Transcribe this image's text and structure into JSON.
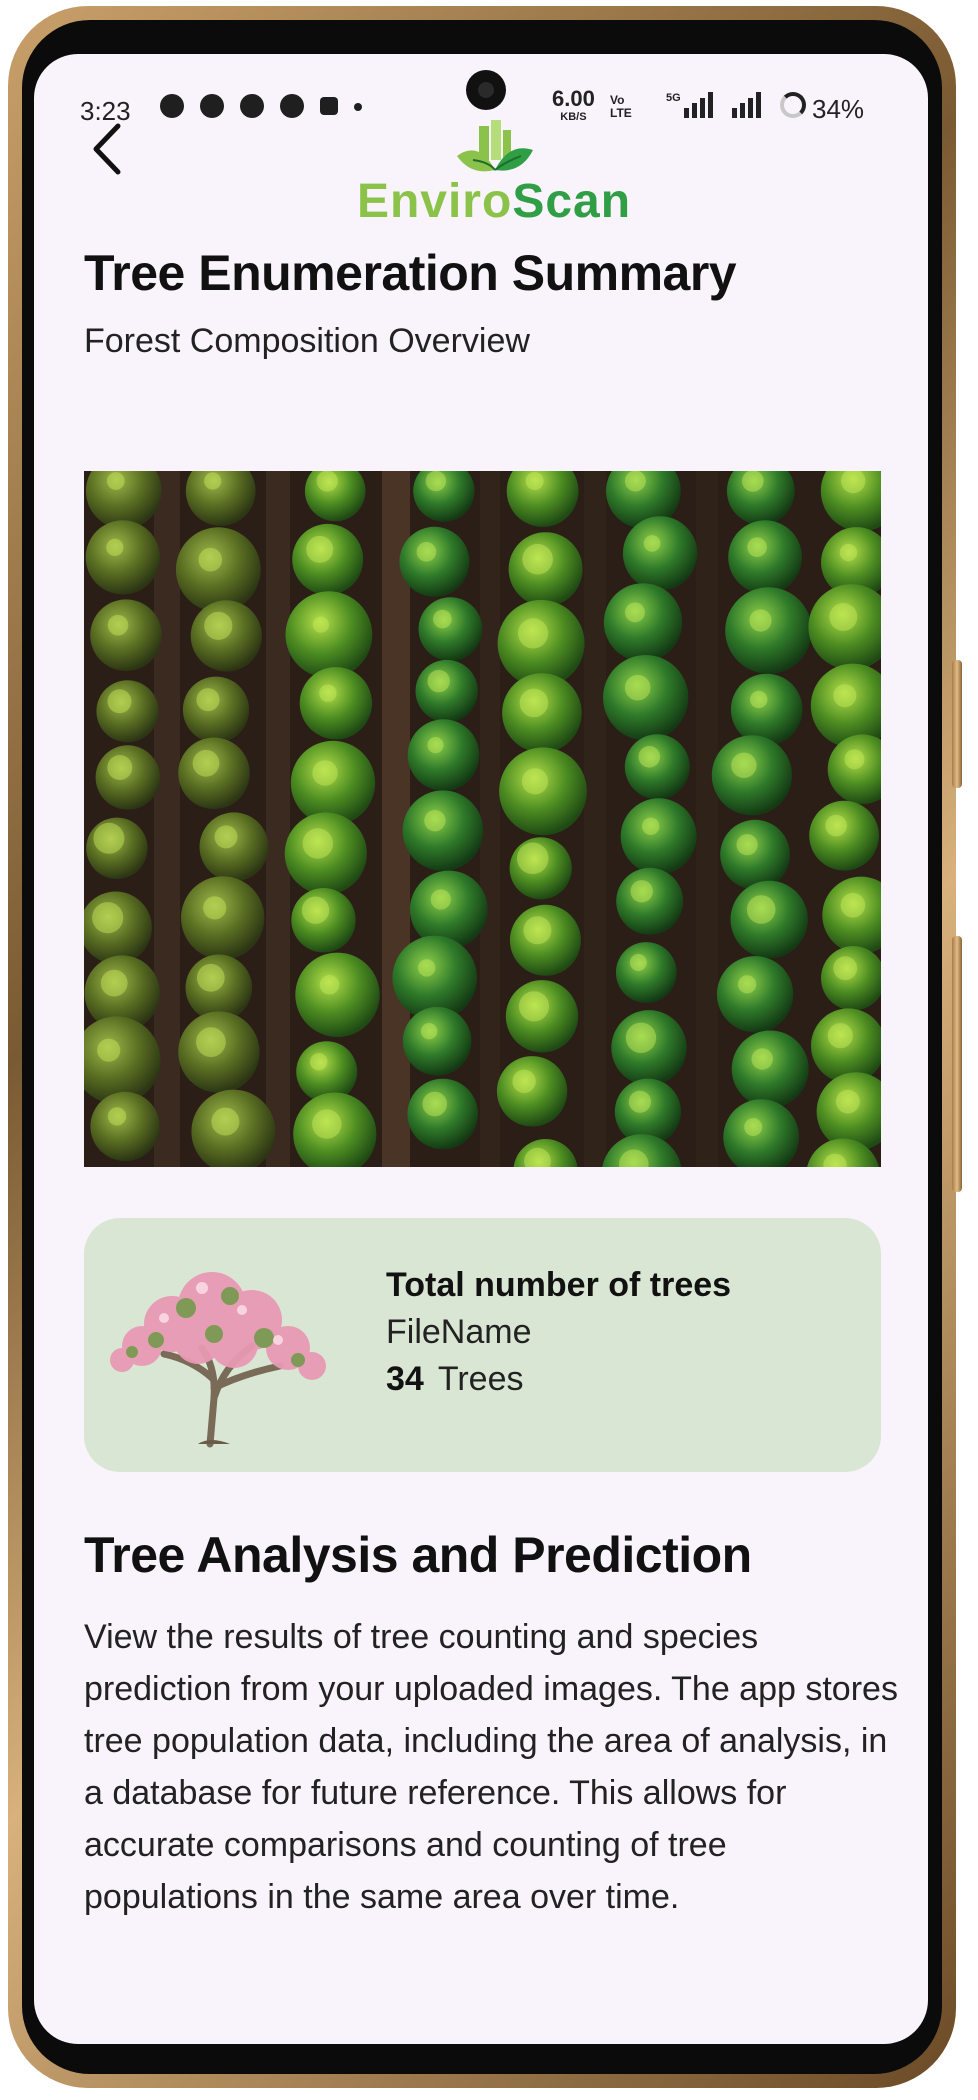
{
  "status_bar": {
    "time": "3:23",
    "net_speed": "6.00",
    "net_speed_unit": "KB/S",
    "volte_top": "Vo",
    "volte_bottom": "LTE",
    "network": "5G",
    "battery": "34%"
  },
  "header": {
    "back_icon": "chevron-left-icon",
    "logo_part1": "Enviro",
    "logo_part2": "Scan"
  },
  "page": {
    "title": "Tree Enumeration Summary",
    "subtitle": "Forest Composition Overview"
  },
  "summary_card": {
    "label": "Total number of trees",
    "filename": "FileName",
    "count": "34",
    "count_unit": "Trees"
  },
  "analysis": {
    "title": "Tree Analysis and Prediction",
    "body": "View the results of tree counting and species prediction from your uploaded images. The app stores tree population data, including the area of analysis, in a database for future reference. This allows for accurate comparisons and counting of tree populations in the same area over time."
  },
  "colors": {
    "screen_bg": "#f9f3fb",
    "card_bg": "#d9e6d4",
    "logo_light_green": "#8bc34a",
    "logo_dark_green": "#2f9e44"
  }
}
